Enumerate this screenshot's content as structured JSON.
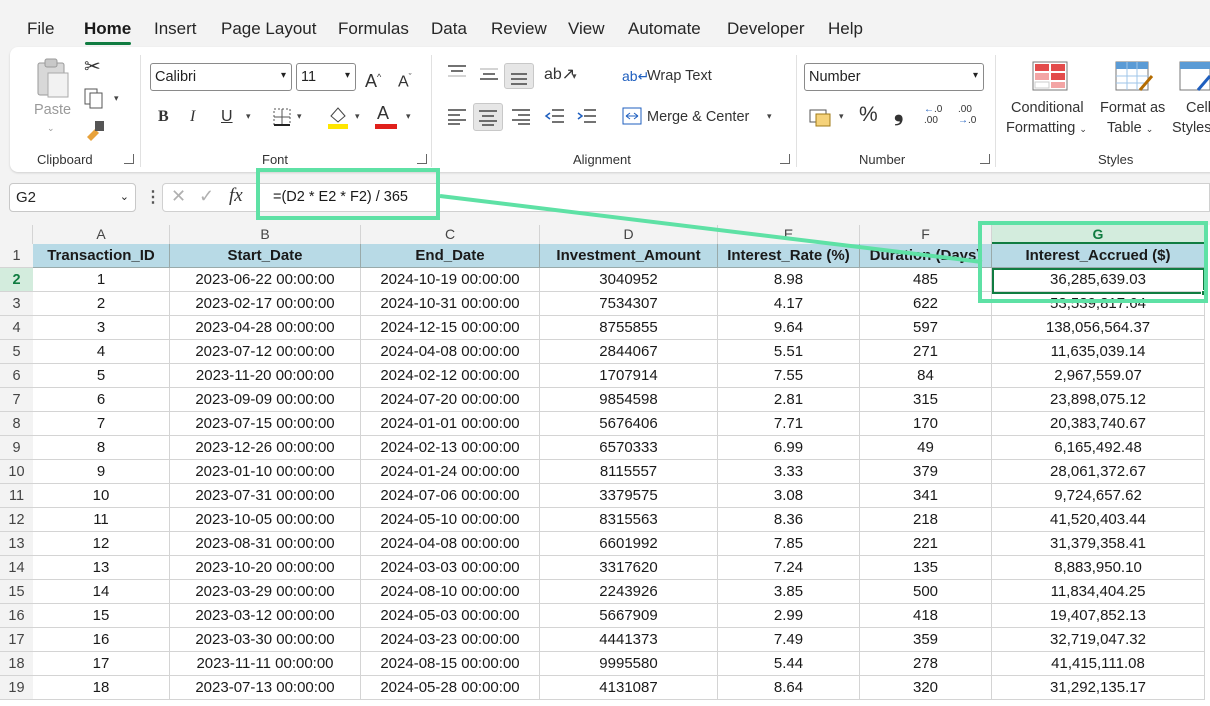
{
  "menu": {
    "items": [
      "File",
      "Home",
      "Insert",
      "Page Layout",
      "Formulas",
      "Data",
      "Review",
      "View",
      "Automate",
      "Developer",
      "Help"
    ]
  },
  "ribbon": {
    "clipboard": {
      "paste": "Paste",
      "label": "Clipboard"
    },
    "font": {
      "name": "Calibri",
      "size": "11",
      "bold": "B",
      "italic": "I",
      "underline": "U",
      "label": "Font",
      "grow": "A",
      "shrink": "A",
      "color_letter": "A"
    },
    "alignment": {
      "wrap_text": "Wrap Text",
      "merge_center": "Merge & Center",
      "label": "Alignment"
    },
    "number": {
      "format": "Number",
      "percent": "%",
      "comma": "❟",
      "inc_decimal": "←.0 .00",
      "dec_decimal": ".00 →.0",
      "label": "Number"
    },
    "styles": {
      "conditional_1": "Conditional",
      "conditional_2": "Formatting",
      "format_table_1": "Format as",
      "format_table_2": "Table",
      "cell_styles_1": "Cell",
      "cell_styles_2": "Styles",
      "label": "Styles"
    }
  },
  "formula_bar": {
    "name_box": "G2",
    "fx": "fx",
    "formula": "=(D2 * E2 * F2) / 365"
  },
  "sheet": {
    "columns": [
      "A",
      "B",
      "C",
      "D",
      "E",
      "F",
      "G"
    ],
    "header": [
      "Transaction_ID",
      "Start_Date",
      "End_Date",
      "Investment_Amount",
      "Interest_Rate (%)",
      "Duration (Days)",
      "Interest_Accrued ($)"
    ],
    "rows": [
      [
        "1",
        "2023-06-22 00:00:00",
        "2024-10-19 00:00:00",
        "3040952",
        "8.98",
        "485",
        "36,285,639.03"
      ],
      [
        "2",
        "2023-02-17 00:00:00",
        "2024-10-31 00:00:00",
        "7534307",
        "4.17",
        "622",
        "53,539,817.64"
      ],
      [
        "3",
        "2023-04-28 00:00:00",
        "2024-12-15 00:00:00",
        "8755855",
        "9.64",
        "597",
        "138,056,564.37"
      ],
      [
        "4",
        "2023-07-12 00:00:00",
        "2024-04-08 00:00:00",
        "2844067",
        "5.51",
        "271",
        "11,635,039.14"
      ],
      [
        "5",
        "2023-11-20 00:00:00",
        "2024-02-12 00:00:00",
        "1707914",
        "7.55",
        "84",
        "2,967,559.07"
      ],
      [
        "6",
        "2023-09-09 00:00:00",
        "2024-07-20 00:00:00",
        "9854598",
        "2.81",
        "315",
        "23,898,075.12"
      ],
      [
        "7",
        "2023-07-15 00:00:00",
        "2024-01-01 00:00:00",
        "5676406",
        "7.71",
        "170",
        "20,383,740.67"
      ],
      [
        "8",
        "2023-12-26 00:00:00",
        "2024-02-13 00:00:00",
        "6570333",
        "6.99",
        "49",
        "6,165,492.48"
      ],
      [
        "9",
        "2023-01-10 00:00:00",
        "2024-01-24 00:00:00",
        "8115557",
        "3.33",
        "379",
        "28,061,372.67"
      ],
      [
        "10",
        "2023-07-31 00:00:00",
        "2024-07-06 00:00:00",
        "3379575",
        "3.08",
        "341",
        "9,724,657.62"
      ],
      [
        "11",
        "2023-10-05 00:00:00",
        "2024-05-10 00:00:00",
        "8315563",
        "8.36",
        "218",
        "41,520,403.44"
      ],
      [
        "12",
        "2023-08-31 00:00:00",
        "2024-04-08 00:00:00",
        "6601992",
        "7.85",
        "221",
        "31,379,358.41"
      ],
      [
        "13",
        "2023-10-20 00:00:00",
        "2024-03-03 00:00:00",
        "3317620",
        "7.24",
        "135",
        "8,883,950.10"
      ],
      [
        "14",
        "2023-03-29 00:00:00",
        "2024-08-10 00:00:00",
        "2243926",
        "3.85",
        "500",
        "11,834,404.25"
      ],
      [
        "15",
        "2023-03-12 00:00:00",
        "2024-05-03 00:00:00",
        "5667909",
        "2.99",
        "418",
        "19,407,852.13"
      ],
      [
        "16",
        "2023-03-30 00:00:00",
        "2024-03-23 00:00:00",
        "4441373",
        "7.49",
        "359",
        "32,719,047.32"
      ],
      [
        "17",
        "2023-11-11 00:00:00",
        "2024-08-15 00:00:00",
        "9995580",
        "5.44",
        "278",
        "41,415,111.08"
      ],
      [
        "18",
        "2023-07-13 00:00:00",
        "2024-05-28 00:00:00",
        "4131087",
        "8.64",
        "320",
        "31,292,135.17"
      ]
    ]
  },
  "annotation": {
    "color": "#5ee1a5"
  },
  "colors": {
    "accent": "#107c41",
    "header_fill": "#b8dae6"
  }
}
